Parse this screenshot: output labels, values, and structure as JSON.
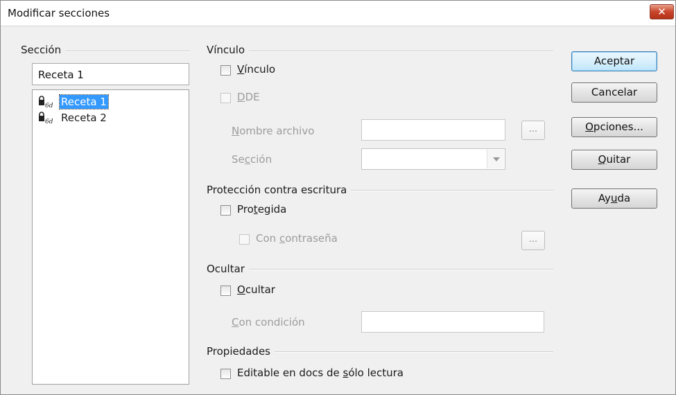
{
  "window": {
    "title": "Modificar secciones",
    "close_glyph": "✕"
  },
  "section_group": {
    "label": "Sección",
    "name_value": "Receta 1",
    "items": [
      {
        "label": "Receta 1",
        "selected": true,
        "icon": "lock-icon"
      },
      {
        "label": "Receta 2",
        "selected": false,
        "icon": "lock-icon"
      }
    ]
  },
  "link_group": {
    "label": "Vínculo",
    "link_checkbox": {
      "label_prefix": "",
      "label_mnemonic": "V",
      "label_suffix": "ínculo",
      "checked": false
    },
    "dde_checkbox": {
      "label_prefix": "",
      "label_mnemonic": "D",
      "label_suffix": "DE",
      "checked": false,
      "enabled": false
    },
    "file_name": {
      "label_prefix": "",
      "label_mnemonic": "N",
      "label_suffix": "ombre archivo",
      "value": ""
    },
    "browse_label": "...",
    "section": {
      "label_prefix": "Se",
      "label_mnemonic": "c",
      "label_suffix": "ción",
      "value": ""
    }
  },
  "protect_group": {
    "label": "Protección contra escritura",
    "protected_checkbox": {
      "label_prefix": "Pro",
      "label_mnemonic": "t",
      "label_suffix": "egida",
      "checked": false
    },
    "password_checkbox": {
      "label_prefix": "Con ",
      "label_mnemonic": "c",
      "label_suffix": "ontraseña",
      "checked": false,
      "enabled": false
    },
    "password_button_label": "..."
  },
  "hide_group": {
    "label": "Ocultar",
    "hide_checkbox": {
      "label_prefix": "",
      "label_mnemonic": "O",
      "label_suffix": "cultar",
      "checked": false
    },
    "condition": {
      "label_prefix": "",
      "label_mnemonic": "C",
      "label_suffix": "on condición",
      "value": ""
    }
  },
  "properties_group": {
    "label": "Propiedades",
    "editable_checkbox": {
      "label_prefix": "Editable en docs de ",
      "label_mnemonic": "s",
      "label_suffix": "ólo lectura",
      "checked": false
    }
  },
  "buttons": {
    "ok": "Aceptar",
    "cancel": "Cancelar",
    "options_prefix": "",
    "options_mnemonic": "O",
    "options_suffix": "pciones...",
    "remove_prefix": "",
    "remove_mnemonic": "Q",
    "remove_suffix": "uitar",
    "help_prefix": "Ay",
    "help_mnemonic": "u",
    "help_suffix": "da"
  }
}
